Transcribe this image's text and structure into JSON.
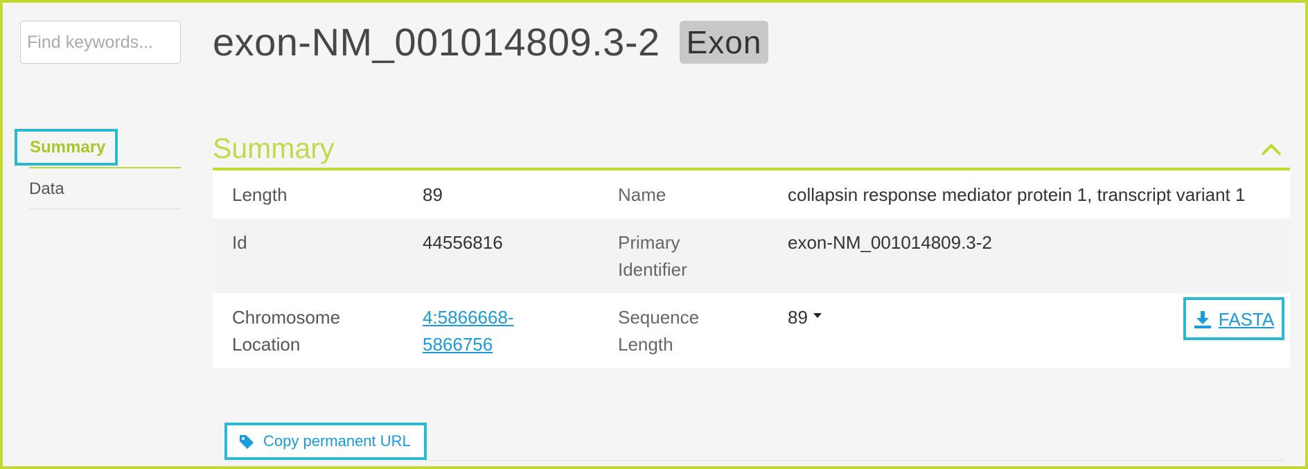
{
  "search": {
    "placeholder": "Find keywords..."
  },
  "header": {
    "title": "exon-NM_001014809.3-2",
    "badge": "Exon"
  },
  "sidebar": {
    "items": [
      {
        "label": "Summary",
        "active": true
      },
      {
        "label": "Data",
        "active": false
      }
    ]
  },
  "summary": {
    "title": "Summary",
    "rows": [
      {
        "label1": "Length",
        "value1": "89",
        "label2": "Name",
        "value2": "collapsin response mediator protein 1, transcript variant 1"
      },
      {
        "label1": "Id",
        "value1": "44556816",
        "label2": "Primary Identifier",
        "value2": "exon-NM_001014809.3-2"
      },
      {
        "label1": "Chromosome Location",
        "value1": "4:5866668-5866756",
        "label2": "Sequence Length",
        "value2": "89",
        "action": "FASTA"
      }
    ]
  },
  "footer": {
    "copy_url_label": "Copy permanent URL"
  },
  "colors": {
    "accent": "#c3d831",
    "highlight": "#2ab8d2",
    "link": "#1a9bdc"
  }
}
